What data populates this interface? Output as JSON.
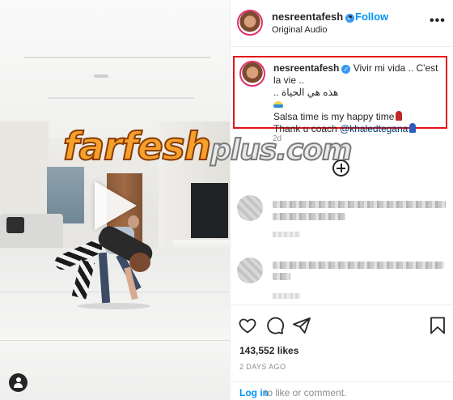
{
  "post": {
    "username": "nesreentafesh",
    "follow_label": "Follow",
    "separator": "•",
    "audio_label": "Original Audio",
    "more_label": "•••"
  },
  "caption": {
    "username": "nesreentafesh",
    "line1": "Vivir mi vida .. C'est la vie ..",
    "line2": "هذه هي الحياة ..",
    "line3": "Salsa time is my happy time",
    "line4_prefix": "Thank u coach",
    "mention": "@khaledtegana",
    "timestamp": "2d"
  },
  "comments": [
    {
      "obscured": true
    },
    {
      "obscured": true
    }
  ],
  "actions": {
    "likes": "143,552 likes",
    "posted_ago": "2 DAYS AGO",
    "login_link": "Log in",
    "login_rest": "to like or comment."
  },
  "watermark": {
    "part1": "farfesh",
    "part2": "plus.com"
  },
  "colors": {
    "accent_blue": "#0095f6",
    "highlight_border": "#e3141b",
    "verified_blue": "#3897f0"
  },
  "icons": [
    "user-tag-icon",
    "verified-icon",
    "more-options-icon",
    "add-comment-icon",
    "heart-icon",
    "comment-icon",
    "share-icon",
    "bookmark-icon",
    "play-icon"
  ]
}
